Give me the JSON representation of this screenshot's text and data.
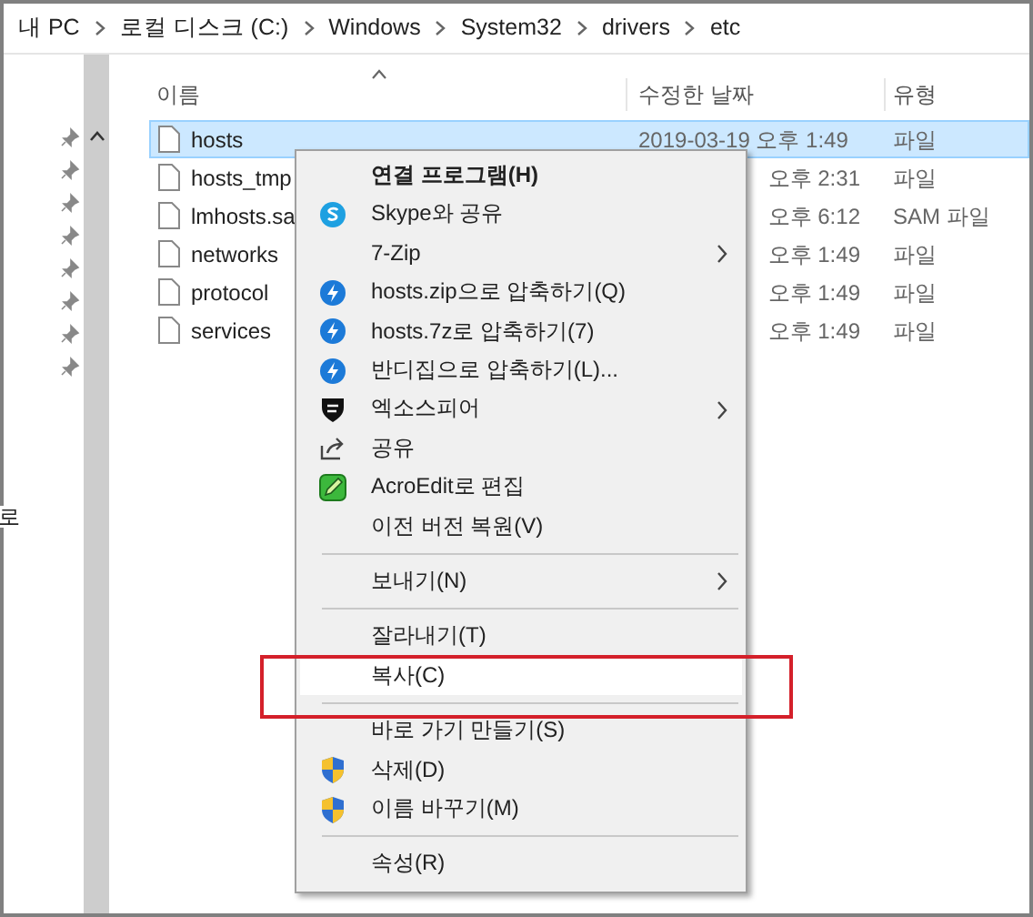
{
  "breadcrumb": [
    "내 PC",
    "로컬 디스크 (C:)",
    "Windows",
    "System32",
    "drivers",
    "etc"
  ],
  "nav_pane": {
    "fragment": "로"
  },
  "file_list": {
    "columns": [
      "이름",
      "수정한 날짜",
      "유형"
    ],
    "rows": [
      {
        "name": "hosts",
        "modified": "2019-03-19 오후 1:49",
        "type": "파일",
        "selected": true
      },
      {
        "name": "hosts_tmp",
        "modified": "오후 2:31",
        "type": "파일",
        "selected": false
      },
      {
        "name": "lmhosts.sa",
        "modified": "오후 6:12",
        "type": "SAM 파일",
        "selected": false
      },
      {
        "name": "networks",
        "modified": "오후 1:49",
        "type": "파일",
        "selected": false
      },
      {
        "name": "protocol",
        "modified": "오후 1:49",
        "type": "파일",
        "selected": false
      },
      {
        "name": "services",
        "modified": "오후 1:49",
        "type": "파일",
        "selected": false
      }
    ]
  },
  "context_menu": [
    {
      "kind": "item",
      "label": "연결 프로그램(H)",
      "default": true,
      "submenu": false,
      "selected": false
    },
    {
      "kind": "item",
      "label": "Skype와 공유",
      "submenu": false,
      "selected": false
    },
    {
      "kind": "item",
      "label": "7-Zip",
      "submenu": true,
      "selected": false
    },
    {
      "kind": "item",
      "label": "hosts.zip으로 압축하기(Q)",
      "submenu": false,
      "selected": false
    },
    {
      "kind": "item",
      "label": "hosts.7z로 압축하기(7)",
      "submenu": false,
      "selected": false
    },
    {
      "kind": "item",
      "label": "반디집으로 압축하기(L)...",
      "submenu": false,
      "selected": false
    },
    {
      "kind": "item",
      "label": "엑소스피어",
      "submenu": true,
      "selected": false
    },
    {
      "kind": "item",
      "label": "공유",
      "submenu": false,
      "selected": false
    },
    {
      "kind": "item",
      "label": "AcroEdit로 편집",
      "submenu": false,
      "selected": false
    },
    {
      "kind": "item",
      "label": "이전 버전 복원(V)",
      "submenu": false,
      "selected": false
    },
    {
      "kind": "separator"
    },
    {
      "kind": "item",
      "label": "보내기(N)",
      "submenu": true,
      "selected": false
    },
    {
      "kind": "separator"
    },
    {
      "kind": "item",
      "label": "잘라내기(T)",
      "submenu": false,
      "selected": false
    },
    {
      "kind": "item",
      "label": "복사(C)",
      "submenu": false,
      "selected": true
    },
    {
      "kind": "separator"
    },
    {
      "kind": "item",
      "label": "바로 가기 만들기(S)",
      "submenu": false,
      "selected": false
    },
    {
      "kind": "item",
      "label": "삭제(D)",
      "submenu": false,
      "selected": false
    },
    {
      "kind": "item",
      "label": "이름 바꾸기(M)",
      "submenu": false,
      "selected": false
    },
    {
      "kind": "separator"
    },
    {
      "kind": "item",
      "label": "속성(R)",
      "submenu": false,
      "selected": false
    }
  ]
}
